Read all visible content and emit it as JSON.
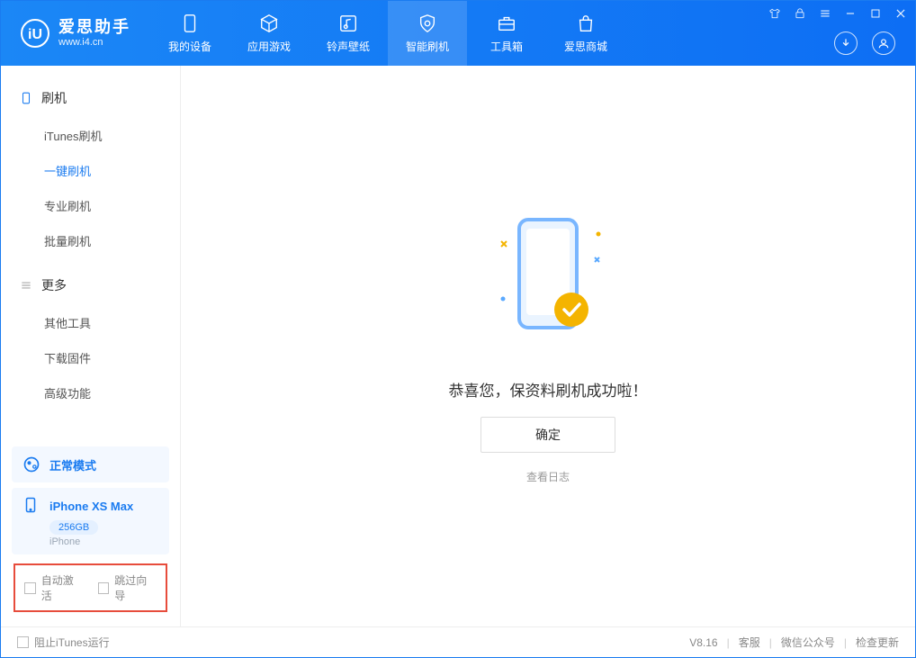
{
  "app": {
    "name": "爱思助手",
    "url": "www.i4.cn"
  },
  "nav": {
    "items": [
      {
        "label": "我的设备"
      },
      {
        "label": "应用游戏"
      },
      {
        "label": "铃声壁纸"
      },
      {
        "label": "智能刷机"
      },
      {
        "label": "工具箱"
      },
      {
        "label": "爱思商城"
      }
    ]
  },
  "sidebar": {
    "sections": [
      {
        "title": "刷机",
        "items": [
          {
            "label": "iTunes刷机"
          },
          {
            "label": "一键刷机"
          },
          {
            "label": "专业刷机"
          },
          {
            "label": "批量刷机"
          }
        ]
      },
      {
        "title": "更多",
        "items": [
          {
            "label": "其他工具"
          },
          {
            "label": "下载固件"
          },
          {
            "label": "高级功能"
          }
        ]
      }
    ],
    "mode": "正常模式",
    "device": {
      "name": "iPhone XS Max",
      "capacity": "256GB",
      "type": "iPhone"
    },
    "options": {
      "auto_activate": "自动激活",
      "skip_guide": "跳过向导"
    }
  },
  "main": {
    "success_message": "恭喜您，保资料刷机成功啦！",
    "ok_label": "确定",
    "log_link": "查看日志"
  },
  "statusbar": {
    "block_itunes": "阻止iTunes运行",
    "version": "V8.16",
    "links": {
      "support": "客服",
      "wechat": "微信公众号",
      "update": "检查更新"
    }
  }
}
